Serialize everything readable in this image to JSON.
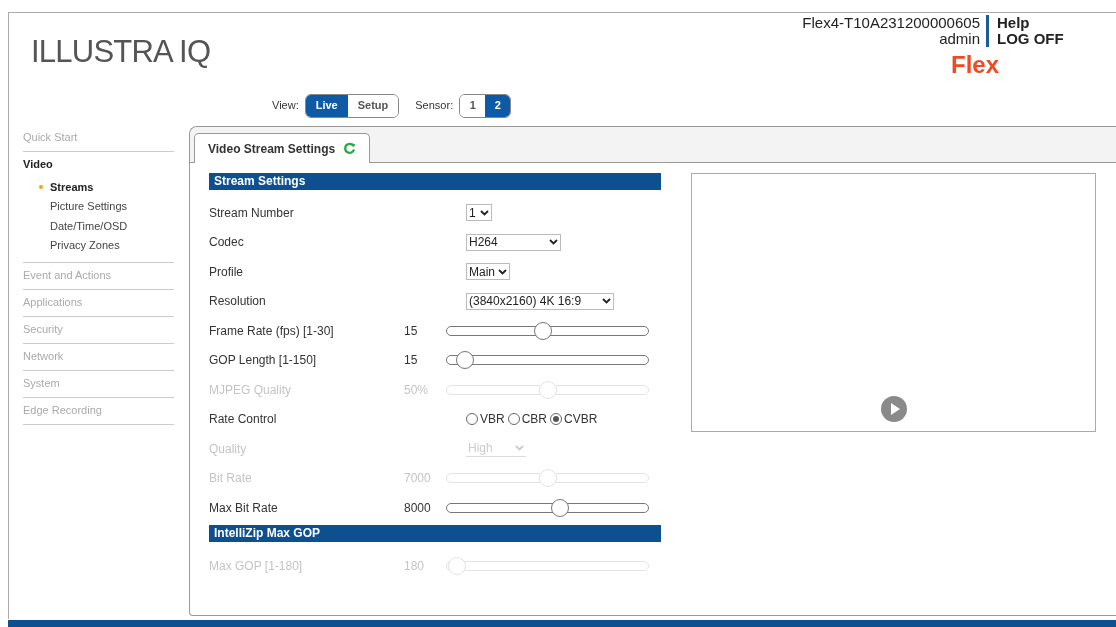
{
  "header": {
    "title": "ILLUSTRA IQ",
    "device": "Flex4-T10A231200000605",
    "user": "admin",
    "links": [
      "Help",
      "LOG OFF"
    ],
    "brand": "Flex"
  },
  "view": {
    "label": "View:",
    "options": [
      {
        "label": "Live",
        "selected": true
      },
      {
        "label": "Setup",
        "selected": false
      }
    ]
  },
  "sensor": {
    "label": "Sensor:",
    "options": [
      {
        "label": "1",
        "selected": false
      },
      {
        "label": "2",
        "selected": true
      }
    ]
  },
  "sidebar": {
    "items": [
      {
        "label": "Quick Start",
        "expanded": false
      },
      {
        "label": "Video",
        "expanded": true,
        "children": [
          {
            "label": "Streams",
            "selected": true
          },
          {
            "label": "Picture Settings",
            "selected": false
          },
          {
            "label": "Date/Time/OSD",
            "selected": false
          },
          {
            "label": "Privacy Zones",
            "selected": false
          }
        ]
      },
      {
        "label": "Event and Actions",
        "expanded": false
      },
      {
        "label": "Applications",
        "expanded": false
      },
      {
        "label": "Security",
        "expanded": false
      },
      {
        "label": "Network",
        "expanded": false
      },
      {
        "label": "System",
        "expanded": false
      },
      {
        "label": "Edge Recording",
        "expanded": false
      }
    ]
  },
  "tab": {
    "label": "Video Stream Settings",
    "selected": true
  },
  "form": [
    {
      "kind": "section",
      "label": "Stream Settings"
    },
    {
      "kind": "select",
      "label": "Stream Number",
      "value": "1",
      "disabled": false
    },
    {
      "kind": "select",
      "label": "Codec",
      "value": "H264",
      "disabled": false
    },
    {
      "kind": "select",
      "label": "Profile",
      "value": "Main",
      "disabled": false
    },
    {
      "kind": "select",
      "label": "Resolution",
      "value": "(3840x2160) 4K 16:9",
      "disabled": false
    },
    {
      "kind": "slider",
      "label": "Frame Rate (fps) [1-30]",
      "reading": "15",
      "level": 0.48,
      "disabled": false
    },
    {
      "kind": "slider",
      "label": "GOP Length [1-150]",
      "reading": "15",
      "level": 0.09,
      "disabled": false
    },
    {
      "kind": "slider",
      "label": "MJPEG Quality",
      "reading": "50%",
      "level": 0.5,
      "disabled": true
    },
    {
      "kind": "radio",
      "label": "Rate Control",
      "options": [
        {
          "label": "VBR",
          "selected": false
        },
        {
          "label": "CBR",
          "selected": false
        },
        {
          "label": "CVBR",
          "selected": true
        }
      ],
      "disabled": false
    },
    {
      "kind": "select",
      "label": "Quality",
      "value": "High",
      "disabled": true
    },
    {
      "kind": "slider",
      "label": "Bit Rate",
      "reading": "7000",
      "level": 0.5,
      "disabled": true
    },
    {
      "kind": "slider",
      "label": "Max Bit Rate",
      "reading": "8000",
      "level": 0.56,
      "disabled": false
    },
    {
      "kind": "section",
      "label": "IntelliZip Max GOP"
    },
    {
      "kind": "slider",
      "label": "Max GOP [1-180]",
      "reading": "180",
      "level": 0.05,
      "disabled": true
    }
  ]
}
